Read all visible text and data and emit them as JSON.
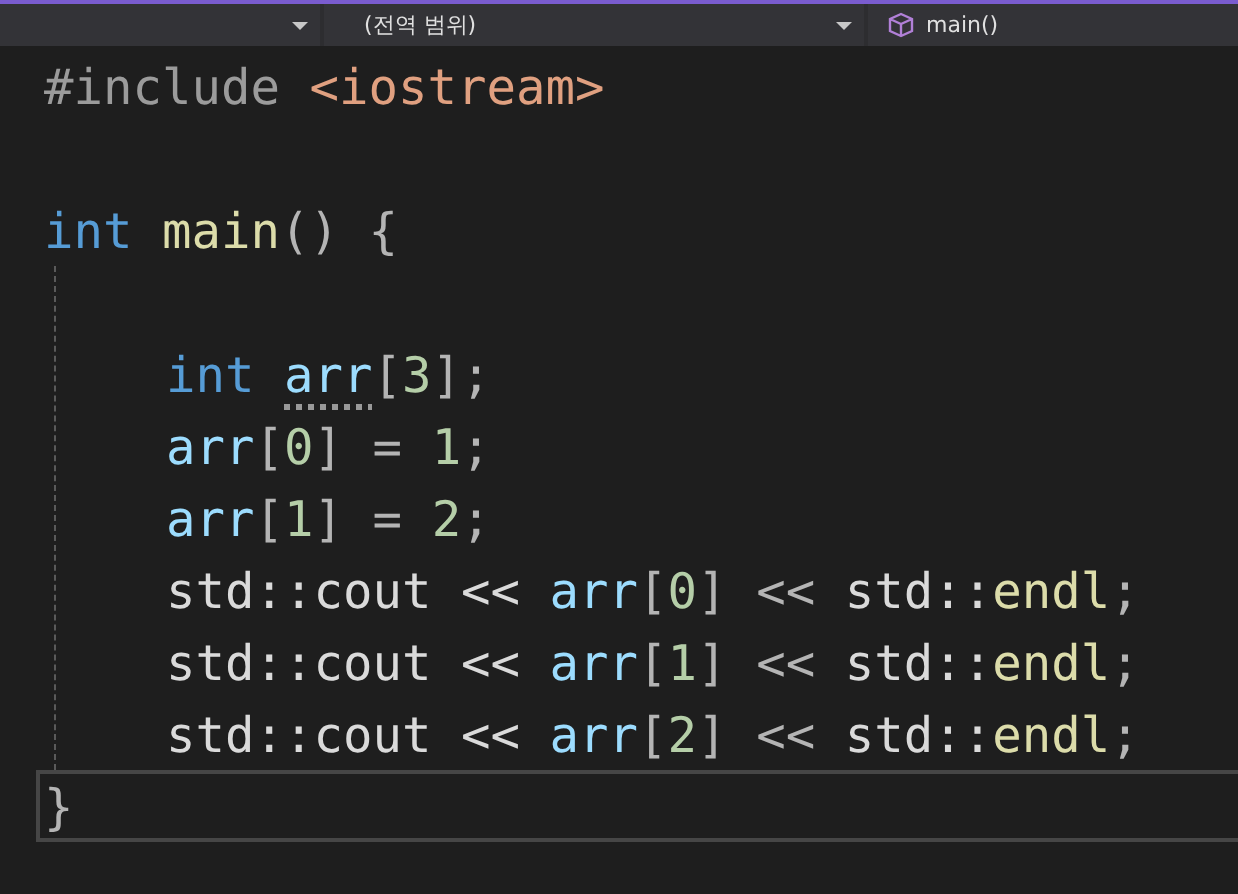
{
  "navigation_bar": {
    "scope_dropdown": {
      "value": "(전역 범위)"
    },
    "member_dropdown": {
      "value": "main()"
    }
  },
  "code_lines": [
    {
      "selected": false,
      "tokens": [
        {
          "kind": "preprocessor",
          "text": "#include "
        },
        {
          "kind": "string",
          "text": "<iostream>"
        }
      ]
    },
    {
      "selected": false
    },
    {
      "selected": false,
      "tokens": [
        {
          "kind": "keyword",
          "text": "int "
        },
        {
          "kind": "function",
          "text": "main"
        },
        {
          "kind": "punct",
          "text": "() {"
        }
      ],
      "children": [
        {
          "selected": false
        },
        {
          "selected": false,
          "tokens": [
            {
              "kind": "keyword",
              "text": "int "
            },
            {
              "kind": "variable",
              "text": "arr",
              "hint": true
            },
            {
              "kind": "punct",
              "text": "["
            },
            {
              "kind": "number",
              "text": "3"
            },
            {
              "kind": "punct",
              "text": "];"
            }
          ]
        },
        {
          "selected": false,
          "tokens": [
            {
              "kind": "variable",
              "text": "arr"
            },
            {
              "kind": "punct",
              "text": "["
            },
            {
              "kind": "number",
              "text": "0"
            },
            {
              "kind": "punct",
              "text": "] = "
            },
            {
              "kind": "number",
              "text": "1"
            },
            {
              "kind": "punct",
              "text": ";"
            }
          ]
        },
        {
          "selected": false,
          "tokens": [
            {
              "kind": "variable",
              "text": "arr"
            },
            {
              "kind": "punct",
              "text": "["
            },
            {
              "kind": "number",
              "text": "1"
            },
            {
              "kind": "punct",
              "text": "] = "
            },
            {
              "kind": "number",
              "text": "2"
            },
            {
              "kind": "punct",
              "text": ";"
            }
          ]
        },
        {
          "selected": false,
          "tokens": [
            {
              "kind": "plain",
              "text": "std::cout << "
            },
            {
              "kind": "variable",
              "text": "arr"
            },
            {
              "kind": "punct",
              "text": "["
            },
            {
              "kind": "number",
              "text": "0"
            },
            {
              "kind": "punct",
              "text": "] << "
            },
            {
              "kind": "plain",
              "text": "std::"
            },
            {
              "kind": "function",
              "text": "endl"
            },
            {
              "kind": "punct",
              "text": ";"
            }
          ]
        },
        {
          "selected": false,
          "tokens": [
            {
              "kind": "plain",
              "text": "std::cout << "
            },
            {
              "kind": "variable",
              "text": "arr"
            },
            {
              "kind": "punct",
              "text": "["
            },
            {
              "kind": "number",
              "text": "1"
            },
            {
              "kind": "punct",
              "text": "] << "
            },
            {
              "kind": "plain",
              "text": "std::"
            },
            {
              "kind": "function",
              "text": "endl"
            },
            {
              "kind": "punct",
              "text": ";"
            }
          ]
        },
        {
          "selected": false,
          "tokens": [
            {
              "kind": "plain",
              "text": "std::cout << "
            },
            {
              "kind": "variable",
              "text": "arr"
            },
            {
              "kind": "punct",
              "text": "["
            },
            {
              "kind": "number",
              "text": "2"
            },
            {
              "kind": "punct",
              "text": "] << "
            },
            {
              "kind": "plain",
              "text": "std::"
            },
            {
              "kind": "function",
              "text": "endl"
            },
            {
              "kind": "punct",
              "text": ";"
            }
          ]
        }
      ]
    },
    {
      "selected": true,
      "tokens": [
        {
          "kind": "punct",
          "text": "}"
        }
      ]
    }
  ]
}
